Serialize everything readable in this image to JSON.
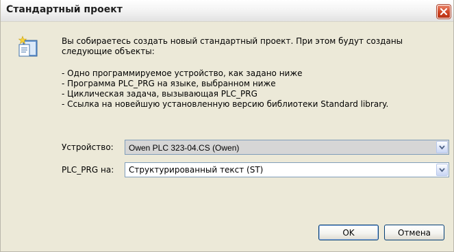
{
  "window": {
    "title": "Стандартный проект"
  },
  "message": {
    "intro": "Вы собираетесь создать новый стандартный проект. При этом будут созданы следующие объекты:",
    "bullets": [
      "- Одно программируемое устройство, как задано ниже",
      "- Программа PLC_PRG на языке, выбранном ниже",
      "- Циклическая задача, вызывающая PLC_PRG",
      "- Ссылка на новейшую установленную версию библиотеки Standard library."
    ]
  },
  "form": {
    "device_label": "Устройство:",
    "device_value": "Owen PLC 323-04.CS (Owen)",
    "language_label": "PLC_PRG на:",
    "language_value": "Структурированный текст (ST)"
  },
  "buttons": {
    "ok": "OK",
    "cancel": "Отмена"
  },
  "colors": {
    "window_bg": "#ece9d8",
    "close_button": "#cf4322",
    "combo_border": "#7f9db9",
    "button_border": "#003c74"
  },
  "icons": {
    "app": "new-project-icon",
    "close": "close-icon",
    "dropdown": "chevron-down-icon"
  }
}
